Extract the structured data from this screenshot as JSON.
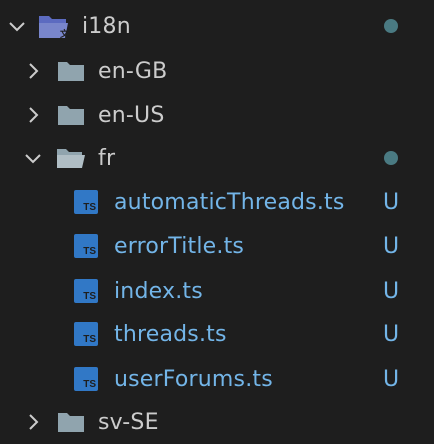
{
  "colors": {
    "background": "#1e1e1e",
    "folder_text": "#cccccc",
    "untracked_text": "#73b5e8",
    "ts_icon": "#3178c6",
    "modified_dot": "#4a7a82"
  },
  "explorer": {
    "root": {
      "label": "i18n",
      "expanded": true,
      "icon": "folder-localization-open-icon",
      "has_changes_dot": true
    },
    "folders": [
      {
        "label": "en-GB",
        "expanded": false,
        "icon": "folder-icon"
      },
      {
        "label": "en-US",
        "expanded": false,
        "icon": "folder-icon"
      },
      {
        "label": "fr",
        "expanded": true,
        "icon": "folder-open-icon",
        "has_changes_dot": true
      },
      {
        "label": "sv-SE",
        "expanded": false,
        "icon": "folder-icon"
      }
    ],
    "fr_files": [
      {
        "label": "automaticThreads.ts",
        "status": "U",
        "icon": "typescript-file-icon",
        "badge": "TS"
      },
      {
        "label": "errorTitle.ts",
        "status": "U",
        "icon": "typescript-file-icon",
        "badge": "TS"
      },
      {
        "label": "index.ts",
        "status": "U",
        "icon": "typescript-file-icon",
        "badge": "TS"
      },
      {
        "label": "threads.ts",
        "status": "U",
        "icon": "typescript-file-icon",
        "badge": "TS"
      },
      {
        "label": "userForums.ts",
        "status": "U",
        "icon": "typescript-file-icon",
        "badge": "TS"
      }
    ]
  }
}
